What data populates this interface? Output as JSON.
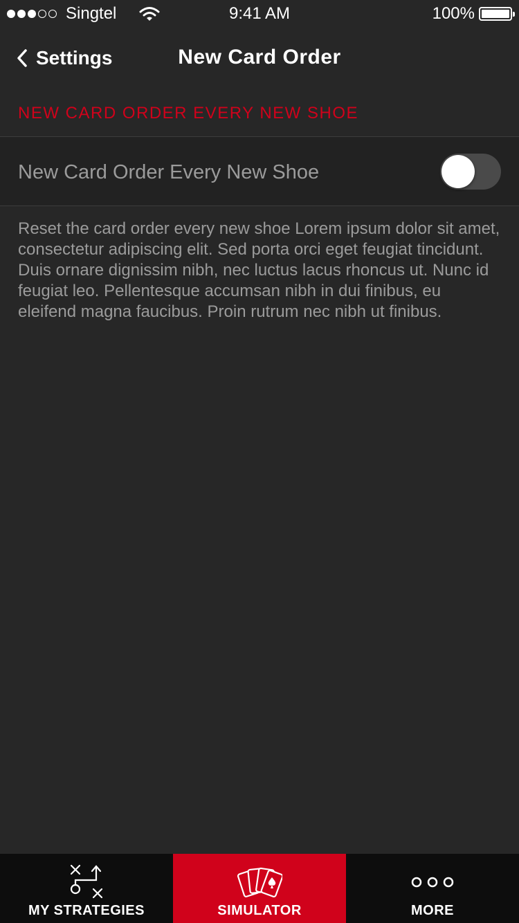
{
  "status_bar": {
    "carrier": "Singtel",
    "signal_bars_filled": 3,
    "signal_bars_total": 5,
    "time": "9:41 AM",
    "battery": "100%"
  },
  "nav": {
    "back_label": "Settings",
    "title": "New Card Order"
  },
  "section": {
    "header": "NEW CARD ORDER EVERY NEW SHOE"
  },
  "setting": {
    "label": "New Card Order Every New Shoe",
    "toggle_on": false
  },
  "description": "Reset the card order every new shoe Lorem ipsum dolor sit amet, consectetur adipiscing elit. Sed porta orci eget feugiat tincidunt. Duis ornare dignissim nibh, nec luctus lacus rhoncus ut. Nunc id feugiat leo. Pellentesque accumsan nibh in dui finibus, eu eleifend magna faucibus. Proin rutrum nec nibh ut finibus.",
  "tabs": [
    {
      "label": "MY STRATEGIES",
      "icon": "strategy-play-icon",
      "active": false
    },
    {
      "label": "SIMULATOR",
      "icon": "playing-cards-icon",
      "active": true
    },
    {
      "label": "MORE",
      "icon": "more-dots-icon",
      "active": false
    }
  ],
  "colors": {
    "background": "#272727",
    "accent": "#d0021b",
    "row_background": "#222222",
    "tab_bar": "#0d0d0d",
    "secondary_text": "#9b9b9b"
  }
}
